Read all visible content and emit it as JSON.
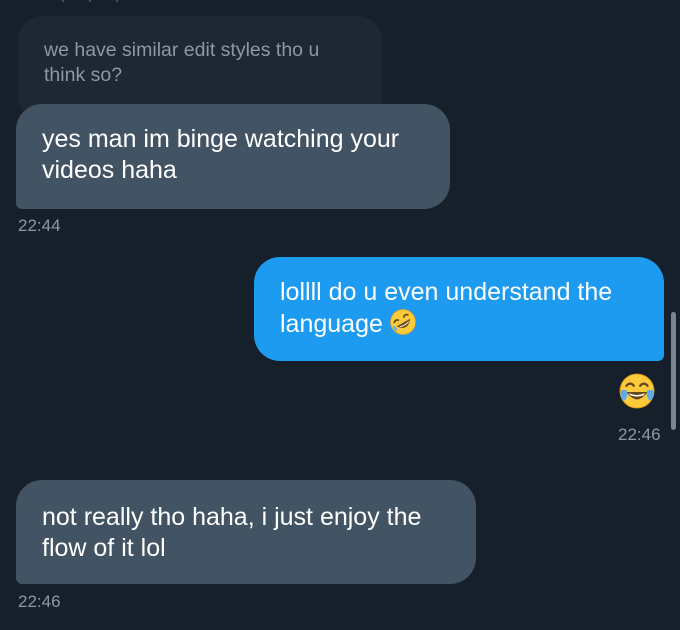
{
  "conversation": {
    "quoted_message": {
      "text": "we have similar edit styles tho u think so?"
    },
    "messages": [
      {
        "direction": "incoming",
        "text": "yes man im binge watching your videos haha",
        "time": "22:44"
      },
      {
        "direction": "outgoing",
        "text": "lollll do u even understand the language",
        "inline_emoji": "rolling-on-the-floor-laughing-emoji",
        "reaction": "face-with-tears-of-joy-emoji",
        "time": "22:46"
      },
      {
        "direction": "incoming",
        "text": "not really tho haha, i just enjoy the flow of it lol",
        "time": "22:46"
      }
    ]
  },
  "colors": {
    "background": "#15202b",
    "incoming_bubble": "#425363",
    "outgoing_bubble": "#1d9bf0",
    "timestamp": "#8b98a5",
    "quoted_bubble": "#1e2732"
  }
}
